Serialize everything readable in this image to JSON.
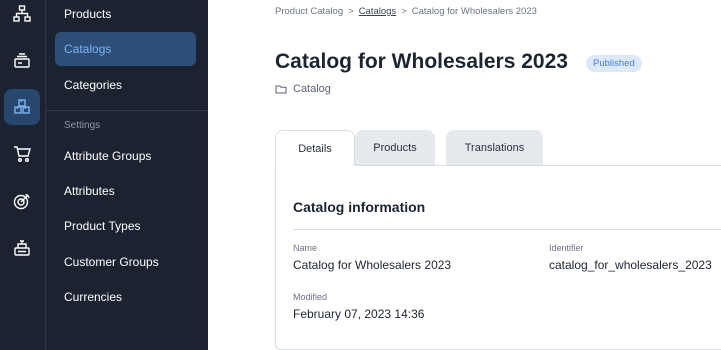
{
  "rail": {
    "items": [
      {
        "icon": "sitemap-icon",
        "active": false
      },
      {
        "icon": "stack-icon",
        "active": false
      },
      {
        "icon": "boxes-icon",
        "active": true
      },
      {
        "icon": "cart-icon",
        "active": false
      },
      {
        "icon": "target-icon",
        "active": false
      },
      {
        "icon": "register-icon",
        "active": false
      }
    ]
  },
  "sidebar": {
    "items": [
      {
        "label": "Products"
      },
      {
        "label": "Catalogs"
      },
      {
        "label": "Categories"
      },
      {
        "label": "Attribute Groups"
      },
      {
        "label": "Attributes"
      },
      {
        "label": "Product Types"
      },
      {
        "label": "Customer Groups"
      },
      {
        "label": "Currencies"
      }
    ],
    "active_item": "Catalogs",
    "section_label": "Settings"
  },
  "breadcrumb": {
    "items": [
      "Product Catalog",
      "Catalogs",
      "Catalog for Wholesalers 2023"
    ],
    "separator": ">"
  },
  "header": {
    "title": "Catalog for Wholesalers 2023",
    "status_badge": "Published",
    "type_label": "Catalog"
  },
  "tabs": {
    "items": [
      {
        "label": "Details",
        "active": true
      },
      {
        "label": "Products",
        "active": false
      },
      {
        "label": "Translations",
        "active": false
      }
    ]
  },
  "panel": {
    "title": "Catalog information",
    "fields": {
      "name": {
        "label": "Name",
        "value": "Catalog for Wholesalers 2023"
      },
      "identifier": {
        "label": "Identifier",
        "value": "catalog_for_wholesalers_2023"
      },
      "modified": {
        "label": "Modified",
        "value": "February 07, 2023 14:36"
      }
    }
  },
  "colors": {
    "sidebar_bg": "#1b2330",
    "active_nav_bg": "#2d4e78",
    "active_nav_text": "#7fb4f2",
    "badge_bg": "#dbe9fb",
    "badge_text": "#4a7ec2"
  }
}
